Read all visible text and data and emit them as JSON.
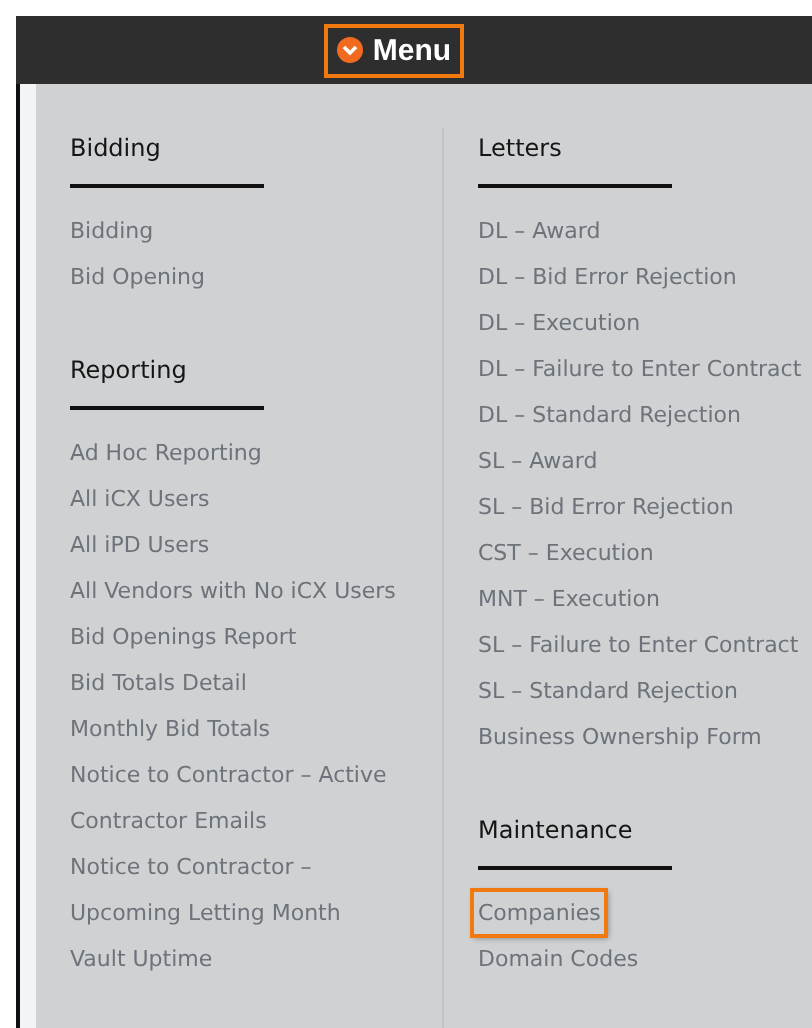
{
  "menu_button": {
    "label": "Menu",
    "highlighted": true
  },
  "columns": [
    {
      "sections": [
        {
          "heading": "Bidding",
          "items": [
            {
              "label": "Bidding",
              "highlighted": false
            },
            {
              "label": "Bid Opening",
              "highlighted": false
            }
          ]
        },
        {
          "heading": "Reporting",
          "items": [
            {
              "label": "Ad Hoc Reporting",
              "highlighted": false
            },
            {
              "label": "All iCX Users",
              "highlighted": false
            },
            {
              "label": "All iPD Users",
              "highlighted": false
            },
            {
              "label": "All Vendors with No iCX Users",
              "highlighted": false
            },
            {
              "label": "Bid Openings Report",
              "highlighted": false
            },
            {
              "label": "Bid Totals Detail",
              "highlighted": false
            },
            {
              "label": "Monthly Bid Totals",
              "highlighted": false
            },
            {
              "label": "Notice to Contractor – Active",
              "highlighted": false
            },
            {
              "label": "Contractor Emails",
              "highlighted": false
            },
            {
              "label": "Notice to Contractor –",
              "highlighted": false
            },
            {
              "label": "Upcoming Letting Month",
              "highlighted": false
            },
            {
              "label": "Vault Uptime",
              "highlighted": false
            }
          ]
        }
      ]
    },
    {
      "sections": [
        {
          "heading": "Letters",
          "items": [
            {
              "label": "DL – Award",
              "highlighted": false
            },
            {
              "label": "DL – Bid Error Rejection",
              "highlighted": false
            },
            {
              "label": "DL – Execution",
              "highlighted": false
            },
            {
              "label": "DL – Failure to Enter Contract",
              "highlighted": false
            },
            {
              "label": "DL – Standard Rejection",
              "highlighted": false
            },
            {
              "label": "SL – Award",
              "highlighted": false
            },
            {
              "label": "SL – Bid Error Rejection",
              "highlighted": false
            },
            {
              "label": "CST – Execution",
              "highlighted": false
            },
            {
              "label": "MNT – Execution",
              "highlighted": false
            },
            {
              "label": "SL – Failure to Enter Contract",
              "highlighted": false
            },
            {
              "label": "SL – Standard Rejection",
              "highlighted": false
            },
            {
              "label": "Business Ownership Form",
              "highlighted": false
            }
          ]
        },
        {
          "heading": "Maintenance",
          "items": [
            {
              "label": "Companies",
              "highlighted": true
            },
            {
              "label": "Domain Codes",
              "highlighted": false
            }
          ]
        }
      ]
    }
  ]
}
